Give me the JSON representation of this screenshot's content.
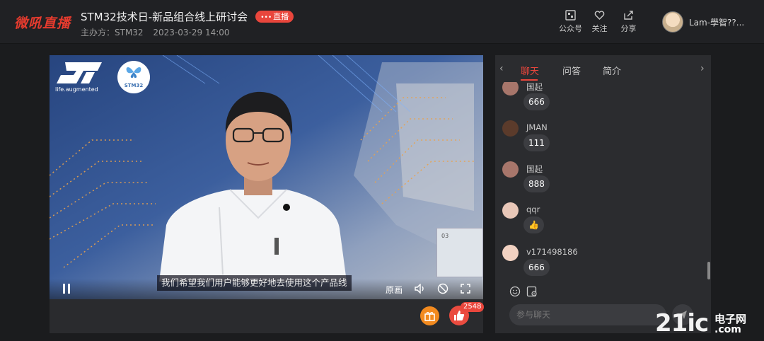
{
  "header": {
    "logo": "微吼直播",
    "title": "STM32技术日-新品组合线上研讨会",
    "live_badge": "直播",
    "organizer": "主办方：STM32",
    "datetime": "2023-03-29 14:00",
    "actions": [
      {
        "label": "公众号",
        "icon": "qrcode-icon"
      },
      {
        "label": "关注",
        "icon": "heart-plus-icon"
      },
      {
        "label": "分享",
        "icon": "share-icon"
      }
    ],
    "user_name": "Lam-學智??..."
  },
  "player": {
    "brand_tagline": "life.augmented",
    "brand_badge": "STM32",
    "screen_thumb_text": "03",
    "subtitle": "我们希望我们用户能够更好地去使用这个产品线",
    "quality_label": "原画",
    "like_count": "2548"
  },
  "chat": {
    "tabs": [
      "聊天",
      "问答",
      "简介"
    ],
    "active_tab": "聊天",
    "messages": [
      {
        "name": "国起",
        "text": "666",
        "avatar_color": "#a7766b"
      },
      {
        "name": "JMAN",
        "text": "111",
        "avatar_color": "#5b3b2b"
      },
      {
        "name": "国起",
        "text": "888",
        "avatar_color": "#a7766b"
      },
      {
        "name": "qqr",
        "text": "👍",
        "avatar_color": "#e8c7b8"
      },
      {
        "name": "v171498186",
        "text": "666",
        "avatar_color": "#f2d2c2"
      }
    ],
    "input_placeholder": "参与聊天"
  },
  "watermark": {
    "brand": "21ic",
    "cn": "电子网",
    "domain": ".com"
  },
  "colors": {
    "accent": "#e9463c",
    "background": "#1b1c1e"
  }
}
